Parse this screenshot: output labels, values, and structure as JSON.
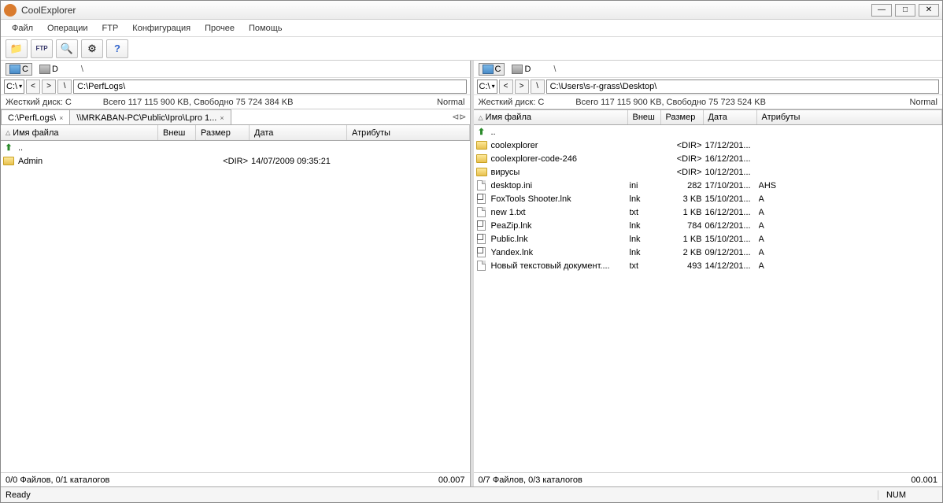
{
  "app": {
    "title": "CoolExplorer"
  },
  "menu": {
    "file": "Файл",
    "operations": "Операции",
    "ftp": "FTP",
    "config": "Конфигурация",
    "other": "Прочее",
    "help": "Помощь"
  },
  "toolbar": {
    "btn1": "folder",
    "btn2": "ftp",
    "btn3": "search",
    "btn4": "settings",
    "btn5": "help"
  },
  "columns": {
    "name": "Имя файла",
    "ext": "Внеш",
    "size": "Размер",
    "date": "Дата",
    "attr": "Атрибуты"
  },
  "left": {
    "drive_label_c": "C",
    "drive_label_d": "D",
    "drive_select": "C:\\",
    "path": "C:\\PerfLogs\\",
    "disk_line": "Жесткий диск: C",
    "disk_space": "Всего 117 115 900 KB, Свободно 75 724 384 KB",
    "mode": "Normal",
    "tabs": [
      {
        "label": "C:\\PerfLogs\\",
        "active": true
      },
      {
        "label": "\\\\MRKABAN-PC\\Public\\Ipro\\Lpro 1...",
        "active": false
      }
    ],
    "colw": {
      "name": 200,
      "ext": 48,
      "size": 68,
      "date": 124,
      "attr": 100
    },
    "rows": [
      {
        "icon": "up",
        "name": "..",
        "ext": "",
        "size": "",
        "date": "",
        "attr": ""
      },
      {
        "icon": "folder",
        "name": "Admin",
        "ext": "",
        "size": "<DIR>",
        "date": "14/07/2009 09:35:21",
        "attr": ""
      }
    ],
    "footer_left": "0/0 Файлов, 0/1 каталогов",
    "footer_right": "00.007"
  },
  "right": {
    "drive_label_c": "C",
    "drive_label_d": "D",
    "drive_select": "C:\\",
    "path": "C:\\Users\\s-r-grass\\Desktop\\",
    "disk_line": "Жесткий диск: C",
    "disk_space": "Всего 117 115 900 KB, Свободно 75 723 524 KB",
    "mode": "Normal",
    "colw": {
      "name": 196,
      "ext": 42,
      "size": 54,
      "date": 68,
      "attr": 100
    },
    "rows": [
      {
        "icon": "up",
        "name": "..",
        "ext": "",
        "size": "",
        "date": "",
        "attr": ""
      },
      {
        "icon": "folder",
        "name": "coolexplorer",
        "ext": "",
        "size": "<DIR>",
        "date": "17/12/201...",
        "attr": ""
      },
      {
        "icon": "folder",
        "name": "coolexplorer-code-246",
        "ext": "",
        "size": "<DIR>",
        "date": "16/12/201...",
        "attr": ""
      },
      {
        "icon": "folder",
        "name": "вирусы",
        "ext": "",
        "size": "<DIR>",
        "date": "10/12/201...",
        "attr": ""
      },
      {
        "icon": "file",
        "name": "desktop.ini",
        "ext": "ini",
        "size": "282",
        "date": "17/10/201...",
        "attr": "AHS"
      },
      {
        "icon": "shortcut",
        "name": "FoxTools Shooter.lnk",
        "ext": "lnk",
        "size": "3 KB",
        "date": "15/10/201...",
        "attr": "A"
      },
      {
        "icon": "file",
        "name": "new 1.txt",
        "ext": "txt",
        "size": "1 KB",
        "date": "16/12/201...",
        "attr": "A"
      },
      {
        "icon": "shortcut",
        "name": "PeaZip.lnk",
        "ext": "lnk",
        "size": "784",
        "date": "06/12/201...",
        "attr": "A"
      },
      {
        "icon": "shortcut",
        "name": "Public.lnk",
        "ext": "lnk",
        "size": "1 KB",
        "date": "15/10/201...",
        "attr": "A"
      },
      {
        "icon": "shortcut",
        "name": "Yandex.lnk",
        "ext": "lnk",
        "size": "2 KB",
        "date": "09/12/201...",
        "attr": "A"
      },
      {
        "icon": "file",
        "name": "Новый текстовый документ....",
        "ext": "txt",
        "size": "493",
        "date": "14/12/201...",
        "attr": "A"
      }
    ],
    "footer_left": "0/7 Файлов, 0/3 каталогов",
    "footer_right": "00.001"
  },
  "status": {
    "ready": "Ready",
    "num": "NUM"
  }
}
